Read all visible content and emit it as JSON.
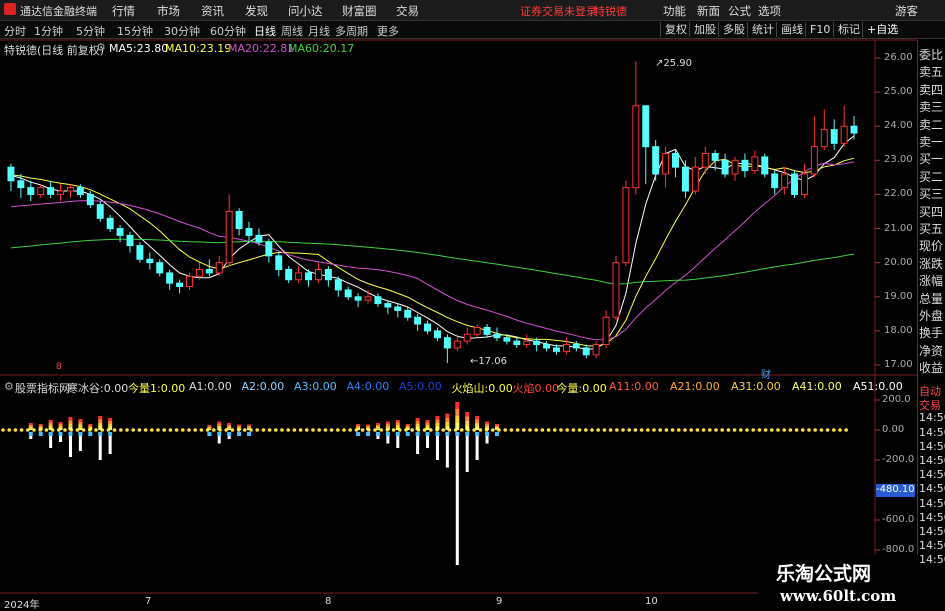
{
  "topbar": {
    "app_name": "通达信金融终端",
    "menu": [
      "行情",
      "市场",
      "资讯",
      "发现",
      "问小达",
      "财富圈",
      "交易"
    ],
    "warning": "证券交易未登录",
    "stock_name": "特锐德",
    "right_menu": [
      "功能",
      "新面",
      "公式",
      "选项"
    ],
    "guest": "游客"
  },
  "periods": [
    "分时",
    "1分钟",
    "5分钟",
    "15分钟",
    "30分钟",
    "60分钟",
    "日线",
    "周线",
    "月线",
    "多周期",
    "更多"
  ],
  "active_period": "日线",
  "toolbar_buttons": [
    "复权",
    "加股",
    "多股",
    "统计",
    "画线",
    "F10",
    "标记",
    "+自选"
  ],
  "chart_info": {
    "title": "特锐德(日线 前复权)",
    "ma": [
      {
        "label": "MA5:",
        "value": "23.80",
        "color": "#ffffff"
      },
      {
        "label": "MA10:",
        "value": "23.19",
        "color": "#ffff4a"
      },
      {
        "label": "MA20:",
        "value": "22.81",
        "color": "#d24fd2"
      },
      {
        "label": "MA60:",
        "value": "20.17",
        "color": "#3fd33f"
      }
    ]
  },
  "price_scale": [
    "26.00",
    "25.00",
    "24.00",
    "23.00",
    "22.00",
    "21.00",
    "20.00",
    "19.00",
    "18.00",
    "17.00"
  ],
  "annotations": {
    "high": "25.90",
    "low": "17.06",
    "event_left": "8",
    "event_right": "财"
  },
  "indicator": {
    "name": "股票指标网",
    "items": [
      {
        "label": "寒冰谷:",
        "value": "0.00",
        "color": "#dddddd"
      },
      {
        "label": "今量1:",
        "value": "0.00",
        "color": "#ffff4a"
      },
      {
        "label": "A1:",
        "value": "0.00",
        "color": "#dddddd"
      },
      {
        "label": "A2:",
        "value": "0.00",
        "color": "#8fd3ff"
      },
      {
        "label": "A3:",
        "value": "0.00",
        "color": "#4ac2ff"
      },
      {
        "label": "A4:",
        "value": "0.00",
        "color": "#3a78ff"
      },
      {
        "label": "A5:",
        "value": "0.00",
        "color": "#1f3fdf"
      },
      {
        "label": "火焰山:",
        "value": "0.00",
        "color": "#ffff4a"
      },
      {
        "label": "火焰",
        "value": "0.00",
        "color": "#ff4040"
      },
      {
        "label": "今量:",
        "value": "0.00",
        "color": "#ffff4a"
      },
      {
        "label": "A11:",
        "value": "0.00",
        "color": "#ff6030"
      },
      {
        "label": "A21:",
        "value": "0.00",
        "color": "#ffae30"
      },
      {
        "label": "A31:",
        "value": "0.00",
        "color": "#ffd040"
      },
      {
        "label": "A41:",
        "value": "0.00",
        "color": "#ffff60"
      },
      {
        "label": "A51:",
        "value": "0.00",
        "color": "#ffffff"
      }
    ]
  },
  "indicator_scale": [
    "200.0",
    "0.00",
    "-200.0",
    "-400.0",
    "-600.0",
    "-800.0"
  ],
  "indicator_cursor": "-480.10",
  "x_labels": [
    "2024年",
    "7",
    "8",
    "9",
    "10"
  ],
  "right_panel": [
    "委比",
    "卖五",
    "卖四",
    "卖三",
    "卖二",
    "卖一",
    "买一",
    "买二",
    "买三",
    "买四",
    "买五",
    "现价",
    "涨跌",
    "涨幅",
    "总量",
    "外盘",
    "换手",
    "净资",
    "收益"
  ],
  "right_panel_lower": [
    "自动",
    "交易",
    "14:50",
    "14:50",
    "14:50",
    "14:50",
    "14:50",
    "14:50",
    "14:50",
    "14:50",
    "14:50",
    "14:50",
    "14:50"
  ],
  "watermark": {
    "line1": "乐淘公式网",
    "line2": "www.60lt.com"
  },
  "chart_data": {
    "type": "candlestick",
    "price_range": [
      17.0,
      26.0
    ],
    "ohlc": [
      [
        22.8,
        22.4,
        22.9,
        22.1
      ],
      [
        22.4,
        22.2,
        22.6,
        21.9
      ],
      [
        22.2,
        22.0,
        22.4,
        21.8
      ],
      [
        22.0,
        22.2,
        22.3,
        21.9
      ],
      [
        22.2,
        22.0,
        22.4,
        21.9
      ],
      [
        22.0,
        22.1,
        22.3,
        21.8
      ],
      [
        22.1,
        22.2,
        22.3,
        21.9
      ],
      [
        22.2,
        22.0,
        22.3,
        21.9
      ],
      [
        22.0,
        21.7,
        22.1,
        21.6
      ],
      [
        21.7,
        21.3,
        21.8,
        21.2
      ],
      [
        21.3,
        21.0,
        21.4,
        20.9
      ],
      [
        21.0,
        20.8,
        21.1,
        20.6
      ],
      [
        20.8,
        20.5,
        20.9,
        20.3
      ],
      [
        20.5,
        20.1,
        20.6,
        20.0
      ],
      [
        20.1,
        20.0,
        20.3,
        19.8
      ],
      [
        20.0,
        19.7,
        20.1,
        19.6
      ],
      [
        19.7,
        19.4,
        19.8,
        19.2
      ],
      [
        19.4,
        19.3,
        19.5,
        19.1
      ],
      [
        19.3,
        19.6,
        19.7,
        19.2
      ],
      [
        19.6,
        19.8,
        20.0,
        19.5
      ],
      [
        19.8,
        19.7,
        20.1,
        19.6
      ],
      [
        19.7,
        20.0,
        20.2,
        19.6
      ],
      [
        20.0,
        21.5,
        22.0,
        19.9
      ],
      [
        21.5,
        21.0,
        21.6,
        20.8
      ],
      [
        21.0,
        20.8,
        21.2,
        20.6
      ],
      [
        20.8,
        20.6,
        21.0,
        20.5
      ],
      [
        20.6,
        20.2,
        20.7,
        20.0
      ],
      [
        20.2,
        19.8,
        20.3,
        19.6
      ],
      [
        19.8,
        19.5,
        19.9,
        19.4
      ],
      [
        19.5,
        19.7,
        19.9,
        19.4
      ],
      [
        19.7,
        19.5,
        19.8,
        19.3
      ],
      [
        19.5,
        19.8,
        20.0,
        19.4
      ],
      [
        19.8,
        19.5,
        19.9,
        19.3
      ],
      [
        19.5,
        19.2,
        19.6,
        19.0
      ],
      [
        19.2,
        19.0,
        19.3,
        18.9
      ],
      [
        19.0,
        18.9,
        19.1,
        18.7
      ],
      [
        18.9,
        19.0,
        19.2,
        18.8
      ],
      [
        19.0,
        18.8,
        19.1,
        18.7
      ],
      [
        18.8,
        18.7,
        18.9,
        18.5
      ],
      [
        18.7,
        18.6,
        18.8,
        18.4
      ],
      [
        18.6,
        18.4,
        18.7,
        18.3
      ],
      [
        18.4,
        18.2,
        18.5,
        18.0
      ],
      [
        18.2,
        18.0,
        18.3,
        17.9
      ],
      [
        18.0,
        17.8,
        18.1,
        17.7
      ],
      [
        17.8,
        17.5,
        17.9,
        17.06
      ],
      [
        17.5,
        17.7,
        17.9,
        17.4
      ],
      [
        17.7,
        17.9,
        18.1,
        17.6
      ],
      [
        17.9,
        18.1,
        18.2,
        17.8
      ],
      [
        18.1,
        17.9,
        18.2,
        17.8
      ],
      [
        17.9,
        17.8,
        18.1,
        17.7
      ],
      [
        17.8,
        17.7,
        17.9,
        17.6
      ],
      [
        17.7,
        17.6,
        17.8,
        17.5
      ],
      [
        17.6,
        17.7,
        17.9,
        17.5
      ],
      [
        17.7,
        17.6,
        17.8,
        17.4
      ],
      [
        17.6,
        17.5,
        17.7,
        17.4
      ],
      [
        17.5,
        17.4,
        17.6,
        17.3
      ],
      [
        17.4,
        17.6,
        17.8,
        17.3
      ],
      [
        17.6,
        17.5,
        17.7,
        17.4
      ],
      [
        17.5,
        17.3,
        17.6,
        17.2
      ],
      [
        17.3,
        17.6,
        17.7,
        17.2
      ],
      [
        17.6,
        18.4,
        18.6,
        17.5
      ],
      [
        18.4,
        20.0,
        20.2,
        18.3
      ],
      [
        20.0,
        22.2,
        22.4,
        19.9
      ],
      [
        22.2,
        24.6,
        25.9,
        22.0
      ],
      [
        24.6,
        23.4,
        24.5,
        22.3
      ],
      [
        23.4,
        22.6,
        23.6,
        22.4
      ],
      [
        22.6,
        23.2,
        23.4,
        22.2
      ],
      [
        23.2,
        22.8,
        23.3,
        22.5
      ],
      [
        22.8,
        22.1,
        23.0,
        21.9
      ],
      [
        22.1,
        22.8,
        23.1,
        22.0
      ],
      [
        22.8,
        23.2,
        23.4,
        22.6
      ],
      [
        23.2,
        23.0,
        23.3,
        22.7
      ],
      [
        23.0,
        22.6,
        23.2,
        22.5
      ],
      [
        22.6,
        23.0,
        23.1,
        22.4
      ],
      [
        23.0,
        22.7,
        23.2,
        22.5
      ],
      [
        22.7,
        23.1,
        23.3,
        22.6
      ],
      [
        23.1,
        22.6,
        23.2,
        22.5
      ],
      [
        22.6,
        22.2,
        22.7,
        22.0
      ],
      [
        22.2,
        22.6,
        22.8,
        22.0
      ],
      [
        22.6,
        22.0,
        22.7,
        21.9
      ],
      [
        22.0,
        22.6,
        22.9,
        21.9
      ],
      [
        22.6,
        23.4,
        24.3,
        22.5
      ],
      [
        23.4,
        23.9,
        24.5,
        23.3
      ],
      [
        23.9,
        23.5,
        24.2,
        23.3
      ],
      [
        23.5,
        24.0,
        24.6,
        23.4
      ],
      [
        24.0,
        23.8,
        24.3,
        23.6
      ]
    ],
    "ma_lines": [
      "MA5",
      "MA10",
      "MA20",
      "MA60"
    ],
    "indicator_bars": [
      {
        "i": 2,
        "v": -60
      },
      {
        "i": 3,
        "v": -40
      },
      {
        "i": 4,
        "v": -120
      },
      {
        "i": 5,
        "v": -80
      },
      {
        "i": 6,
        "v": -180
      },
      {
        "i": 7,
        "v": -140
      },
      {
        "i": 8,
        "v": -40
      },
      {
        "i": 9,
        "v": -200
      },
      {
        "i": 10,
        "v": -160
      },
      {
        "i": 20,
        "v": -20
      },
      {
        "i": 21,
        "v": -90
      },
      {
        "i": 22,
        "v": -60
      },
      {
        "i": 23,
        "v": -30
      },
      {
        "i": 24,
        "v": -30
      },
      {
        "i": 35,
        "v": -40
      },
      {
        "i": 36,
        "v": -30
      },
      {
        "i": 37,
        "v": -60
      },
      {
        "i": 38,
        "v": -90
      },
      {
        "i": 39,
        "v": -120
      },
      {
        "i": 40,
        "v": -40
      },
      {
        "i": 41,
        "v": -160
      },
      {
        "i": 42,
        "v": -120
      },
      {
        "i": 43,
        "v": -200
      },
      {
        "i": 44,
        "v": -250
      },
      {
        "i": 45,
        "v": -900
      },
      {
        "i": 46,
        "v": -280
      },
      {
        "i": 47,
        "v": -200
      },
      {
        "i": 48,
        "v": -90
      },
      {
        "i": 49,
        "v": -40
      }
    ]
  }
}
